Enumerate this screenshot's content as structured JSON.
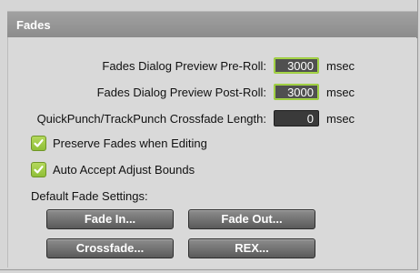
{
  "panel": {
    "title": "Fades"
  },
  "settings": {
    "preroll": {
      "label": "Fades Dialog Preview Pre-Roll:",
      "value": "3000",
      "unit": "msec"
    },
    "postroll": {
      "label": "Fades Dialog Preview Post-Roll:",
      "value": "3000",
      "unit": "msec"
    },
    "crossfade_length": {
      "label": "QuickPunch/TrackPunch Crossfade Length:",
      "value": "0",
      "unit": "msec"
    }
  },
  "checkboxes": {
    "preserve_fades": {
      "label": "Preserve Fades when Editing",
      "checked": true
    },
    "auto_accept": {
      "label": "Auto Accept Adjust Bounds",
      "checked": true
    }
  },
  "default_fades": {
    "label": "Default Fade Settings:",
    "buttons": {
      "fade_in": "Fade In...",
      "fade_out": "Fade Out...",
      "crossfade": "Crossfade...",
      "rex": "REX..."
    }
  },
  "colors": {
    "check_accent": "#a4cc47",
    "field_bg": "#3a3a3a",
    "title_bg": "#979797"
  }
}
